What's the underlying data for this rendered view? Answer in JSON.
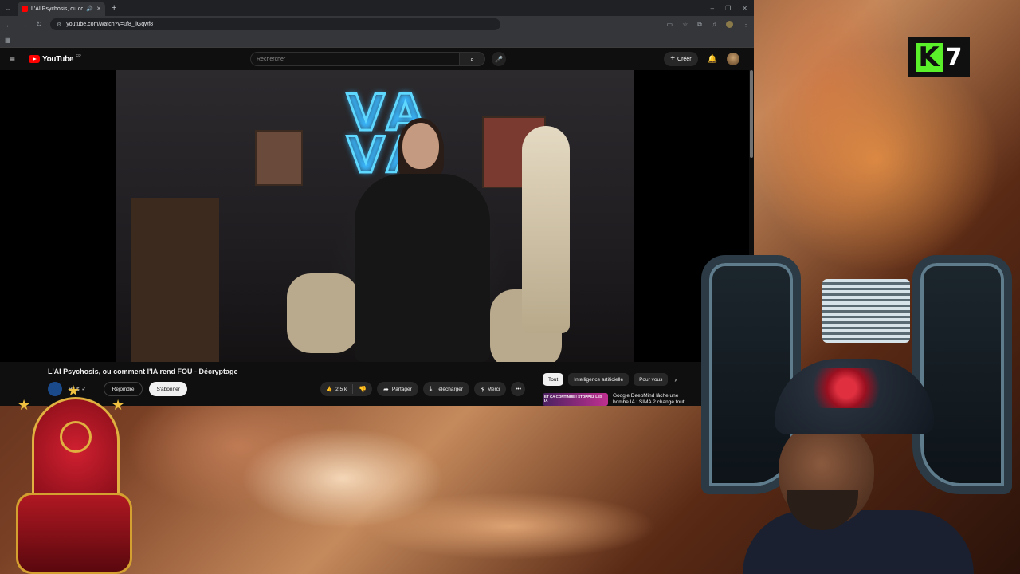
{
  "browser": {
    "tab_title": "L'AI Psychosis, ou comment l'IA rend FOU",
    "url": "youtube.com/watch?v=uf8_liGqwf8",
    "window_controls": [
      "–",
      "❐",
      "✕"
    ]
  },
  "youtube": {
    "logo_text": "YouTube",
    "region": "FR",
    "search_placeholder": "Rechercher",
    "create_label": "Créer"
  },
  "video": {
    "neon_text_top": "VA",
    "neon_text_bottom": "VA",
    "title": "L'AI Psychosis, ou comment l'IA rend FOU - Décryptage",
    "channel_name": "Plus",
    "join_label": "Rejoindre",
    "subscribe_label": "S'abonner",
    "likes": "2,5 k",
    "share_label": "Partager",
    "download_label": "Télécharger",
    "thanks_label": "Merci"
  },
  "sidebar": {
    "chips": [
      "Tout",
      "Intelligence artificielle",
      "Pour vous"
    ],
    "active_chip": "Tout",
    "rec_thumb_text": "ET ÇA CONTINUE ! STOPPEZ LES IA",
    "rec_title": "Google DeepMind lâche une bombe IA : SIMA 2 change tout"
  },
  "overlay": {
    "logo_letter": "K",
    "logo_number": "7"
  },
  "colors": {
    "youtube_red": "#ff0000",
    "neon_blue": "#5fd8ff",
    "k7_green": "#5af02a",
    "throne_red": "#b01822",
    "gold": "#e0b040"
  }
}
